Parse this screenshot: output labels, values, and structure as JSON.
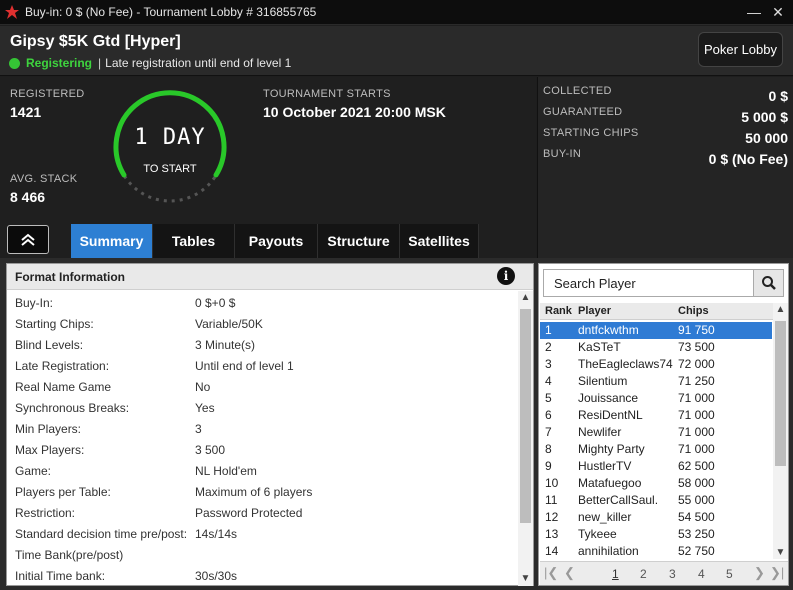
{
  "window": {
    "title": "Buy-in: 0 $ (No Fee) - Tournament Lobby # 316855765",
    "minimize": "—",
    "close": "✕"
  },
  "header": {
    "tournament_name": "Gipsy $5K Gtd [Hyper]",
    "status": "Registering",
    "separator": "|",
    "late_reg_note": "Late registration until end of level 1",
    "lobby_button": "Poker Lobby"
  },
  "stats": {
    "registered_label": "REGISTERED",
    "registered_value": "1421",
    "avg_stack_label": "AVG. STACK",
    "avg_stack_value": "8 466",
    "countdown_value": "1 DAY",
    "countdown_label": "TO START",
    "starts_label": "TOURNAMENT STARTS",
    "starts_value": "10 October 2021  20:00 MSK"
  },
  "prize": [
    {
      "label": "COLLECTED",
      "value": "0 $"
    },
    {
      "label": "GUARANTEED",
      "value": "5 000 $"
    },
    {
      "label": "STARTING CHIPS",
      "value": "50 000"
    },
    {
      "label": "BUY-IN",
      "value": "0 $ (No Fee)"
    }
  ],
  "tabs": [
    {
      "label": "Summary",
      "active": true
    },
    {
      "label": "Tables",
      "active": false
    },
    {
      "label": "Payouts",
      "active": false
    },
    {
      "label": "Structure",
      "active": false
    },
    {
      "label": "Satellites",
      "active": false
    }
  ],
  "format": {
    "title": "Format Information",
    "info_icon": "i",
    "rows": [
      {
        "k": "Buy-In:",
        "v": "0 $+0 $"
      },
      {
        "k": "Starting Chips:",
        "v": "Variable/50K"
      },
      {
        "k": "Blind Levels:",
        "v": "3 Minute(s)"
      },
      {
        "k": "Late Registration:",
        "v": "Until end of level 1"
      },
      {
        "k": "Real Name Game",
        "v": "No"
      },
      {
        "k": "Synchronous Breaks:",
        "v": "Yes"
      },
      {
        "k": "Min Players:",
        "v": "3"
      },
      {
        "k": "Max Players:",
        "v": "3 500"
      },
      {
        "k": "Game:",
        "v": "NL Hold'em"
      },
      {
        "k": "Players per Table:",
        "v": "Maximum of 6 players"
      },
      {
        "k": "Restriction:",
        "v": "Password Protected"
      },
      {
        "k": "Standard decision time pre/post:",
        "v": "14s/14s"
      },
      {
        "k": "Time Bank(pre/post)",
        "v": ""
      },
      {
        "k": "Initial Time bank:",
        "v": "30s/30s"
      }
    ]
  },
  "players": {
    "search_placeholder": "Search Player",
    "columns": {
      "rank": "Rank",
      "player": "Player",
      "chips": "Chips"
    },
    "rows": [
      {
        "rank": "1",
        "player": "dntfckwthm",
        "chips": "91 750"
      },
      {
        "rank": "2",
        "player": "KaSTeT",
        "chips": "73 500"
      },
      {
        "rank": "3",
        "player": "TheEagleclaws74",
        "chips": "72 000"
      },
      {
        "rank": "4",
        "player": "Silentium",
        "chips": "71 250"
      },
      {
        "rank": "5",
        "player": "Jouissance",
        "chips": "71 000"
      },
      {
        "rank": "6",
        "player": "ResiDentNL",
        "chips": "71 000"
      },
      {
        "rank": "7",
        "player": "Newlifer",
        "chips": "71 000"
      },
      {
        "rank": "8",
        "player": "Mighty Party",
        "chips": "71 000"
      },
      {
        "rank": "9",
        "player": "HustlerTV",
        "chips": "62 500"
      },
      {
        "rank": "10",
        "player": "Matafuegoo",
        "chips": "58 000"
      },
      {
        "rank": "11",
        "player": "BetterCallSaul.",
        "chips": "55 000"
      },
      {
        "rank": "12",
        "player": "new_killer",
        "chips": "54 500"
      },
      {
        "rank": "13",
        "player": "Tykeee",
        "chips": "53 250"
      },
      {
        "rank": "14",
        "player": "annihilation",
        "chips": "52 750"
      }
    ],
    "pages": [
      "1",
      "2",
      "3",
      "4",
      "5"
    ],
    "current_page": "1"
  },
  "colors": {
    "accent_blue": "#2d7fd3",
    "status_green": "#3ed43e",
    "ring_green": "#29c829"
  }
}
